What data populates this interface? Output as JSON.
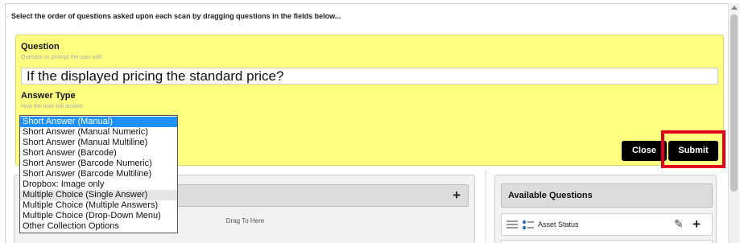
{
  "instructions": "Select the order of questions asked upon each scan by dragging questions in the fields below...",
  "question_form": {
    "question_label": "Question",
    "question_help": "Question to prompt the user with",
    "question_value": "If the displayed pricing the standard price?",
    "answer_type_label": "Answer Type",
    "answer_type_help": "How the user will answer",
    "answer_type_options": [
      "Short Answer (Manual)",
      "Short Answer (Manual Numeric)",
      "Short Answer (Manual Multiline)",
      "Short Answer (Barcode)",
      "Short Answer (Barcode Numeric)",
      "Short Answer (Barcode Multiline)",
      "Dropbox: Image only",
      "Multiple Choice (Single Answer)",
      "Multiple Choice (Multiple Answers)",
      "Multiple Choice (Drop-Down Menu)",
      "Other Collection Options"
    ],
    "selected_option": "Short Answer (Manual)",
    "hovered_option": "Multiple Choice (Single Answer)",
    "close_label": "Close",
    "submit_label": "Submit",
    "highlight_color": "#e0001b",
    "panel_color": "#ffff80"
  },
  "selected_questions": {
    "plus_icon": "+",
    "drop_hint": "Drag To Here"
  },
  "available_questions": {
    "title": "Available Questions",
    "items": [
      {
        "label": "Asset Status",
        "edit_icon": "pencil-icon",
        "add_icon": "+"
      }
    ]
  }
}
